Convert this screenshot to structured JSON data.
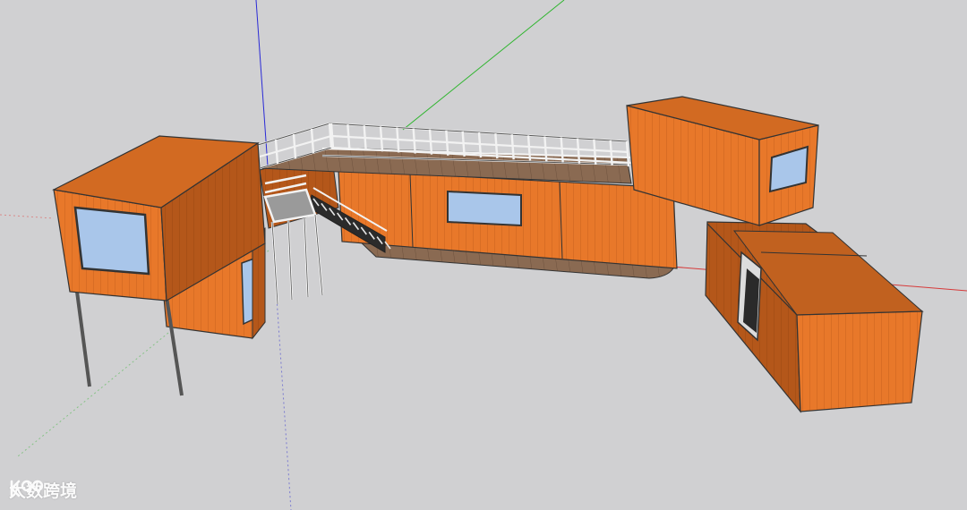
{
  "scene": {
    "background": "#d0d0d2",
    "container_color": "#e8782a",
    "container_dark": "#b4571a",
    "container_top": "#d26a22",
    "deck_color": "#8a6a52",
    "rail_color": "#f2f2f2",
    "window_color": "#a9c6ea",
    "axes": {
      "blue": "#2a2ad6",
      "green": "#2fb52f",
      "red": "#d63a3a"
    }
  },
  "watermark": {
    "text": "大数跨境",
    "logo_name": "k100-logo"
  }
}
